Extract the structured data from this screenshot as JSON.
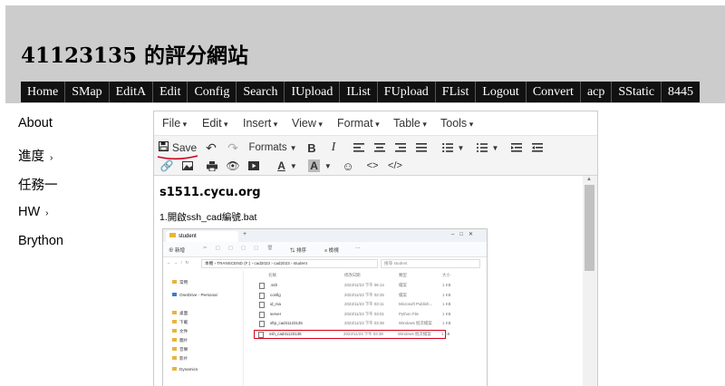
{
  "site": {
    "title": "41123135 的評分網站"
  },
  "topnav": [
    "Home",
    "SMap",
    "EditA",
    "Edit",
    "Config",
    "Search",
    "IUpload",
    "IList",
    "FUpload",
    "FList",
    "Logout",
    "Convert",
    "acp",
    "SStatic",
    "8445"
  ],
  "sidebar": [
    {
      "label": "About",
      "has_arrow": false
    },
    {
      "label": "進度",
      "has_arrow": true
    },
    {
      "label": "任務一",
      "has_arrow": false
    },
    {
      "label": "HW",
      "has_arrow": true
    },
    {
      "label": "Brython",
      "has_arrow": false
    }
  ],
  "editor": {
    "menus": [
      "File",
      "Edit",
      "Insert",
      "View",
      "Format",
      "Table",
      "Tools"
    ],
    "toolbar": {
      "save_label": "Save",
      "formats_label": "Formats"
    },
    "content": {
      "heading": "s1511.cycu.org",
      "step": "1.開啟ssh_cad編號.bat"
    }
  },
  "screenshot": {
    "tab_title": "student",
    "toolbar_new": "新增",
    "toolbar_sort": "排序",
    "toolbar_view": "檢視",
    "address": "本機 › TRANSCEND (F:) › cad2023 › cad2023 › student",
    "search_placeholder": "搜尋 student",
    "nav_items": [
      "常用",
      "OneDrive - Personal",
      "桌面",
      "下載",
      "文件",
      "圖片",
      "音樂",
      "影片",
      "Dynamics"
    ],
    "columns": [
      "名稱",
      "修改日期",
      "類型",
      "大小"
    ],
    "files": [
      {
        "name": ".ssh",
        "date": "2023/11/23 下午 06:14",
        "type": "檔案",
        "size": "1 KB"
      },
      {
        "name": "config",
        "date": "2023/11/23 下午 02:25",
        "type": "檔案",
        "size": "1 KB"
      },
      {
        "name": "id_rsa",
        "date": "2023/11/23 下午 03:11",
        "type": "Microsoft Publish...",
        "size": "1 KB"
      },
      {
        "name": "server",
        "date": "2023/11/23 下午 03:01",
        "type": "Python File",
        "size": "1 KB"
      },
      {
        "name": "sftp_cad41123135",
        "date": "2023/11/23 下午 03:38",
        "type": "Windows 批次檔案",
        "size": "1 KB"
      },
      {
        "name": "ssh_cad41123135",
        "date": "2023/11/23 下午 03:38",
        "type": "Windows 批次檔案",
        "size": "1 KB",
        "highlighted": true
      }
    ]
  },
  "colors": {
    "header_bg": "#cccccc",
    "nav_bg": "#111111",
    "highlight": "#d0021b",
    "folder": "#e8b53a"
  }
}
